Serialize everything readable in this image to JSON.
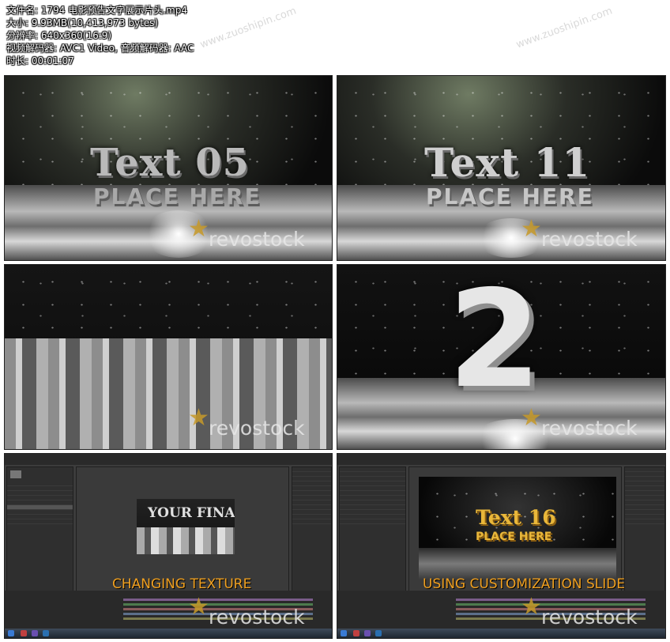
{
  "info": {
    "filename": "文件名: 1794 电影预告文字展示片头.mp4",
    "size": "大小: 9.93MB(10,413,973 bytes)",
    "resolution": "分辨率: 640x360(16:9)",
    "codec": "视频解码器: AVC1 Video, 音频解码器: AAC",
    "duration": "时长: 00:01:07"
  },
  "watermark": "www.zuoshipin.com",
  "brand": "revostock",
  "thumbs": [
    {
      "line1": "Text 05",
      "line2": "PLACE HERE"
    },
    {
      "line1": "Text 11",
      "line2": "PLACE HERE"
    },
    {
      "line1": "",
      "line2": ""
    },
    {
      "number": "2"
    }
  ],
  "screens": [
    {
      "preview_text": "YOUR FINAL",
      "caption": "CHANGING TEXTURE"
    },
    {
      "preview_line1": "Text 16",
      "preview_line2": "PLACE HERE",
      "caption": "USING CUSTOMIZATION SLIDERS"
    }
  ],
  "colors": {
    "accent": "#f0a020",
    "gold": "#e9b73a"
  }
}
